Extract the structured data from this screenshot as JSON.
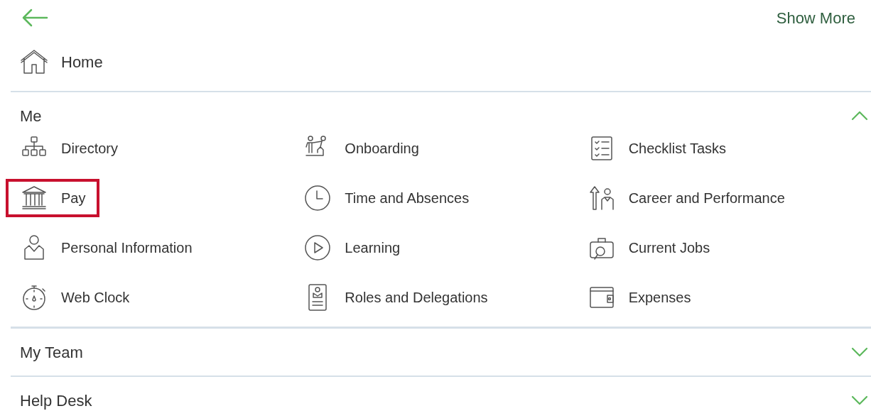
{
  "header": {
    "show_more": "Show More"
  },
  "home": {
    "label": "Home"
  },
  "sections": [
    {
      "title": "Me",
      "expanded": true,
      "items": [
        {
          "label": "Directory",
          "highlighted": false
        },
        {
          "label": "Onboarding",
          "highlighted": false
        },
        {
          "label": "Checklist Tasks",
          "highlighted": false
        },
        {
          "label": "Pay",
          "highlighted": true
        },
        {
          "label": "Time and Absences",
          "highlighted": false
        },
        {
          "label": "Career and Performance",
          "highlighted": false
        },
        {
          "label": "Personal Information",
          "highlighted": false
        },
        {
          "label": "Learning",
          "highlighted": false
        },
        {
          "label": "Current Jobs",
          "highlighted": false
        },
        {
          "label": "Web Clock",
          "highlighted": false
        },
        {
          "label": "Roles and Delegations",
          "highlighted": false
        },
        {
          "label": "Expenses",
          "highlighted": false
        }
      ]
    },
    {
      "title": "My Team",
      "expanded": false
    },
    {
      "title": "Help Desk",
      "expanded": false
    }
  ]
}
